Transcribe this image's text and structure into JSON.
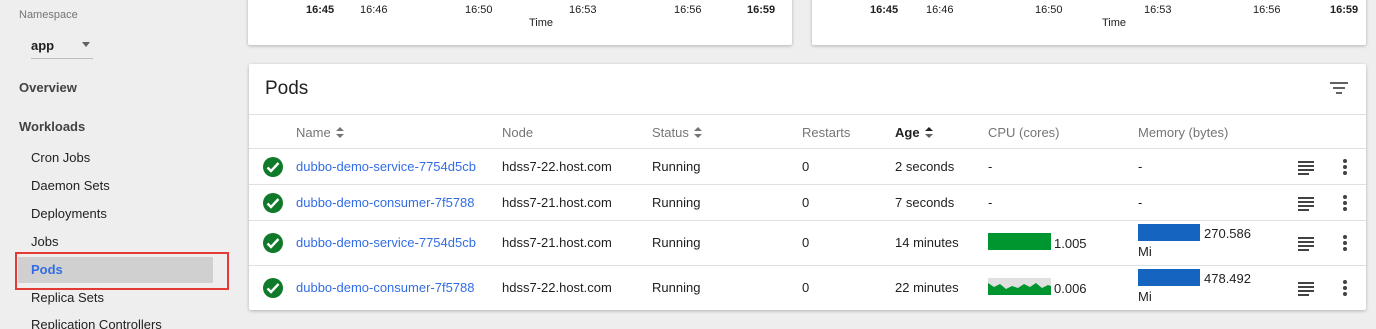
{
  "sidebar": {
    "namespace_label": "Namespace",
    "namespace_value": "app",
    "overview": "Overview",
    "workloads": "Workloads",
    "items": [
      {
        "label": "Cron Jobs"
      },
      {
        "label": "Daemon Sets"
      },
      {
        "label": "Deployments"
      },
      {
        "label": "Jobs"
      },
      {
        "label": "Pods"
      },
      {
        "label": "Replica Sets"
      },
      {
        "label": "Replication Controllers"
      }
    ]
  },
  "charts": [
    {
      "ticks": [
        "16:45",
        "16:46",
        "16:50",
        "16:53",
        "16:56",
        "16:59"
      ],
      "axis_title": "Time"
    },
    {
      "ticks": [
        "16:45",
        "16:46",
        "16:50",
        "16:53",
        "16:56",
        "16:59"
      ],
      "axis_title": "Time"
    }
  ],
  "pods": {
    "title": "Pods",
    "columns": {
      "name": "Name",
      "node": "Node",
      "status": "Status",
      "restarts": "Restarts",
      "age": "Age",
      "cpu": "CPU (cores)",
      "memory": "Memory (bytes)"
    },
    "rows": [
      {
        "name": "dubbo-demo-service-7754d5cb",
        "node": "hdss7-22.host.com",
        "status": "Running",
        "restarts": "0",
        "age": "2 seconds",
        "cpu": "-",
        "memory": "-"
      },
      {
        "name": "dubbo-demo-consumer-7f5788",
        "node": "hdss7-21.host.com",
        "status": "Running",
        "restarts": "0",
        "age": "7 seconds",
        "cpu": "-",
        "memory": "-"
      },
      {
        "name": "dubbo-demo-service-7754d5cb",
        "node": "hdss7-21.host.com",
        "status": "Running",
        "restarts": "0",
        "age": "14 minutes",
        "cpu": "1.005",
        "memory": "270.586",
        "memory_unit": "Mi"
      },
      {
        "name": "dubbo-demo-consumer-7f5788",
        "node": "hdss7-22.host.com",
        "status": "Running",
        "restarts": "0",
        "age": "22 minutes",
        "cpu": "0.006",
        "memory": "478.492",
        "memory_unit": "Mi"
      }
    ]
  },
  "colors": {
    "accent": "#326de6",
    "running": "#0f7a2a",
    "cpu_bar": "#00962f",
    "memory_bar": "#1565c0",
    "highlight": "#e53935"
  }
}
